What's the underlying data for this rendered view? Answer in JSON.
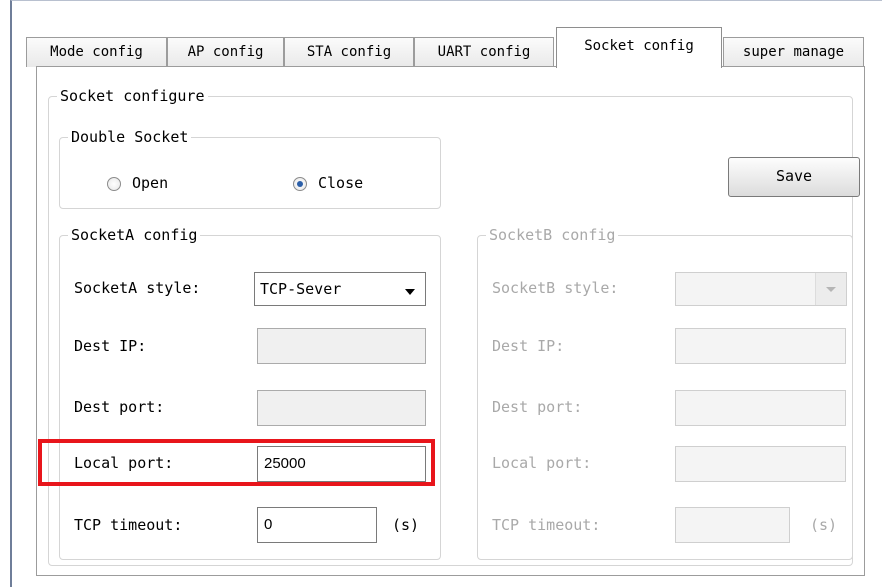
{
  "tabs": [
    {
      "label": "Mode config"
    },
    {
      "label": "AP config"
    },
    {
      "label": "STA config"
    },
    {
      "label": "UART config"
    },
    {
      "label": "Socket config"
    },
    {
      "label": "super manage"
    }
  ],
  "active_tab": "Socket config",
  "socket_configure": {
    "title": "Socket configure",
    "double_socket": {
      "title": "Double Socket",
      "open_label": "Open",
      "close_label": "Close",
      "selected": "Close"
    },
    "save_label": "Save",
    "socket_a": {
      "title": "SocketA config",
      "style_label": "SocketA style:",
      "style_value": "TCP-Sever",
      "dest_ip_label": "Dest IP:",
      "dest_ip_value": "",
      "dest_port_label": "Dest port:",
      "dest_port_value": "",
      "local_port_label": "Local port:",
      "local_port_value": "25000",
      "tcp_timeout_label": "TCP timeout:",
      "tcp_timeout_value": "0",
      "timeout_unit": "(s)"
    },
    "socket_b": {
      "title": "SocketB config",
      "style_label": "SocketB style:",
      "style_value": "",
      "dest_ip_label": "Dest IP:",
      "dest_port_label": "Dest port:",
      "local_port_label": "Local port:",
      "tcp_timeout_label": "TCP timeout:",
      "timeout_unit": "(s)"
    }
  },
  "colors": {
    "highlight": "#e8151b",
    "radio_selected": "#2c5fa8",
    "disabled_text": "#a9a9a9"
  }
}
